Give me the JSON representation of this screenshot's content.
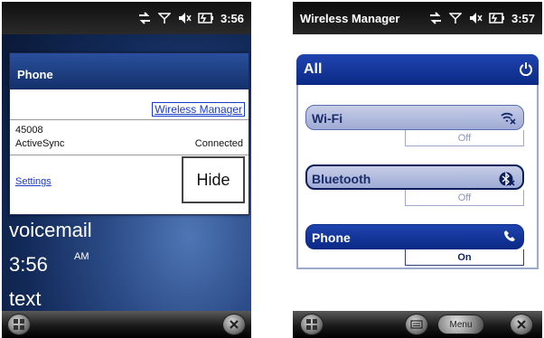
{
  "left_screen": {
    "status": {
      "time": "3:56"
    },
    "dialog": {
      "title": "Phone",
      "link": "Wireless Manager",
      "operator": "45008",
      "activesync_label": "ActiveSync",
      "activesync_status": "Connected",
      "settings_link": "Settings",
      "hide_button": "Hide"
    },
    "home": {
      "voicemail": "voicemail",
      "time": "3:56",
      "ampm": "AM",
      "text": "text"
    }
  },
  "right_screen": {
    "status": {
      "title": "Wireless Manager",
      "time": "3:57"
    },
    "all": {
      "label": "All"
    },
    "items": [
      {
        "label": "Wi-Fi",
        "state": "Off",
        "icon": "wifi-off-icon"
      },
      {
        "label": "Bluetooth",
        "state": "Off",
        "icon": "bluetooth-off-icon"
      },
      {
        "label": "Phone",
        "state": "On",
        "icon": "phone-icon"
      }
    ],
    "softkeys": {
      "menu": "Menu"
    }
  },
  "colors": {
    "accent_blue": "#0b2a86",
    "disabled_blue": "#a6b1db",
    "link_blue": "#1a3ac8",
    "home_bg": "#2c4c88"
  }
}
